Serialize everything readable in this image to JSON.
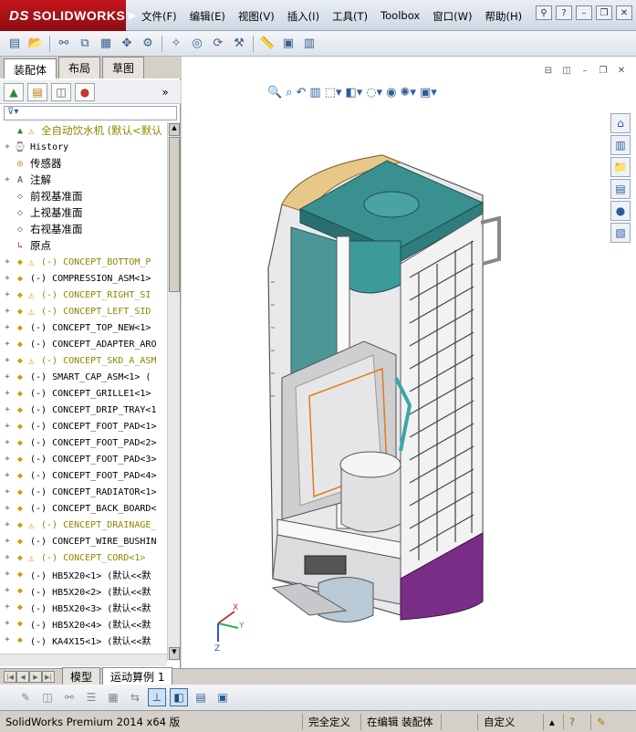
{
  "titlebar": {
    "logo_ds": "DS",
    "logo_text": "SOLIDWORKS",
    "menu": [
      "文件(F)",
      "编辑(E)",
      "视图(V)",
      "插入(I)",
      "工具(T)",
      "Toolbox",
      "窗口(W)",
      "帮助(H)"
    ],
    "help_symbol": "?"
  },
  "left_panel": {
    "tabs": [
      "装配体",
      "布局",
      "草图"
    ],
    "active_tab": "装配体",
    "tree": [
      {
        "label": "全自动饮水机  (默认<默认",
        "warn": true,
        "olive": true,
        "cn": true,
        "icon": "assembly-icon",
        "expand": ""
      },
      {
        "label": "History",
        "warn": false,
        "olive": false,
        "cn": false,
        "icon": "history-icon",
        "expand": "+"
      },
      {
        "label": "传感器",
        "warn": false,
        "olive": false,
        "cn": true,
        "icon": "sensor-icon",
        "expand": ""
      },
      {
        "label": "注解",
        "warn": false,
        "olive": false,
        "cn": true,
        "icon": "annotation-icon",
        "expand": "+"
      },
      {
        "label": "前视基准面",
        "warn": false,
        "olive": false,
        "cn": true,
        "icon": "plane-icon",
        "expand": ""
      },
      {
        "label": "上视基准面",
        "warn": false,
        "olive": false,
        "cn": true,
        "icon": "plane-icon",
        "expand": ""
      },
      {
        "label": "右视基准面",
        "warn": false,
        "olive": false,
        "cn": true,
        "icon": "plane-icon",
        "expand": ""
      },
      {
        "label": "原点",
        "warn": false,
        "olive": false,
        "cn": true,
        "icon": "origin-icon",
        "expand": ""
      },
      {
        "label": "(-) CONCEPT_BOTTOM_P",
        "warn": true,
        "olive": true,
        "cn": false,
        "icon": "component-icon",
        "expand": "+"
      },
      {
        "label": "(-) COMPRESSION_ASM<1>",
        "warn": false,
        "olive": false,
        "cn": false,
        "icon": "component-icon",
        "expand": "+"
      },
      {
        "label": "(-) CONCEPT_RIGHT_SI",
        "warn": true,
        "olive": true,
        "cn": false,
        "icon": "component-icon",
        "expand": "+"
      },
      {
        "label": "(-) CONCEPT_LEFT_SID",
        "warn": true,
        "olive": true,
        "cn": false,
        "icon": "component-icon",
        "expand": "+"
      },
      {
        "label": "(-) CONCEPT_TOP_NEW<1>",
        "warn": false,
        "olive": false,
        "cn": false,
        "icon": "component-icon",
        "expand": "+"
      },
      {
        "label": "(-) CONCEPT_ADAPTER_ARO",
        "warn": false,
        "olive": false,
        "cn": false,
        "icon": "component-icon",
        "expand": "+"
      },
      {
        "label": "(-) CONCEPT_SKD_A_ASM",
        "warn": true,
        "olive": true,
        "cn": false,
        "icon": "component-icon",
        "expand": "+"
      },
      {
        "label": "(-) SMART_CAP_ASM<1> (",
        "warn": false,
        "olive": false,
        "cn": false,
        "icon": "component-icon",
        "expand": "+"
      },
      {
        "label": "(-) CONCEPT_GRILLE1<1>",
        "warn": false,
        "olive": false,
        "cn": false,
        "icon": "component-icon",
        "expand": "+"
      },
      {
        "label": "(-) CONCEPT_DRIP_TRAY<1",
        "warn": false,
        "olive": false,
        "cn": false,
        "icon": "component-icon",
        "expand": "+"
      },
      {
        "label": "(-) CONCEPT_FOOT_PAD<1>",
        "warn": false,
        "olive": false,
        "cn": false,
        "icon": "component-icon",
        "expand": "+"
      },
      {
        "label": "(-) CONCEPT_FOOT_PAD<2>",
        "warn": false,
        "olive": false,
        "cn": false,
        "icon": "component-icon",
        "expand": "+"
      },
      {
        "label": "(-) CONCEPT_FOOT_PAD<3>",
        "warn": false,
        "olive": false,
        "cn": false,
        "icon": "component-icon",
        "expand": "+"
      },
      {
        "label": "(-) CONCEPT_FOOT_PAD<4>",
        "warn": false,
        "olive": false,
        "cn": false,
        "icon": "component-icon",
        "expand": "+"
      },
      {
        "label": "(-) CONCEPT_RADIATOR<1>",
        "warn": false,
        "olive": false,
        "cn": false,
        "icon": "component-icon",
        "expand": "+"
      },
      {
        "label": "(-) CONCEPT_BACK_BOARD<",
        "warn": false,
        "olive": false,
        "cn": false,
        "icon": "component-icon",
        "expand": "+"
      },
      {
        "label": "(-) CENCEPT_DRAINAGE_",
        "warn": true,
        "olive": true,
        "cn": false,
        "icon": "component-icon",
        "expand": "+"
      },
      {
        "label": "(-) CONCEPT_WIRE_BUSHIN",
        "warn": false,
        "olive": false,
        "cn": false,
        "icon": "component-icon",
        "expand": "+"
      },
      {
        "label": "(-) CONCEPT_CORD<1>",
        "warn": true,
        "olive": true,
        "cn": false,
        "icon": "component-icon",
        "expand": "+"
      },
      {
        "label": "(-) HB5X20<1> (默认<<默",
        "warn": false,
        "olive": false,
        "cn": false,
        "icon": "component-icon",
        "expand": "+"
      },
      {
        "label": "(-) HB5X20<2> (默认<<默",
        "warn": false,
        "olive": false,
        "cn": false,
        "icon": "component-icon",
        "expand": "+"
      },
      {
        "label": "(-) HB5X20<3> (默认<<默",
        "warn": false,
        "olive": false,
        "cn": false,
        "icon": "component-icon",
        "expand": "+"
      },
      {
        "label": "(-) HB5X20<4> (默认<<默",
        "warn": false,
        "olive": false,
        "cn": false,
        "icon": "component-icon",
        "expand": "+"
      },
      {
        "label": "(-) KA4X15<1> (默认<<默",
        "warn": false,
        "olive": false,
        "cn": false,
        "icon": "component-icon",
        "expand": "+"
      }
    ]
  },
  "bottom_tabs": {
    "tabs": [
      "模型",
      "运动算例 1"
    ],
    "active": "运动算例 1"
  },
  "triad": {
    "x": "X",
    "y": "Y",
    "z": "Z"
  },
  "status": {
    "product": "SolidWorks Premium 2014 x64 版",
    "defined": "完全定义",
    "editing": "在编辑 装配体",
    "custom": "自定义"
  }
}
